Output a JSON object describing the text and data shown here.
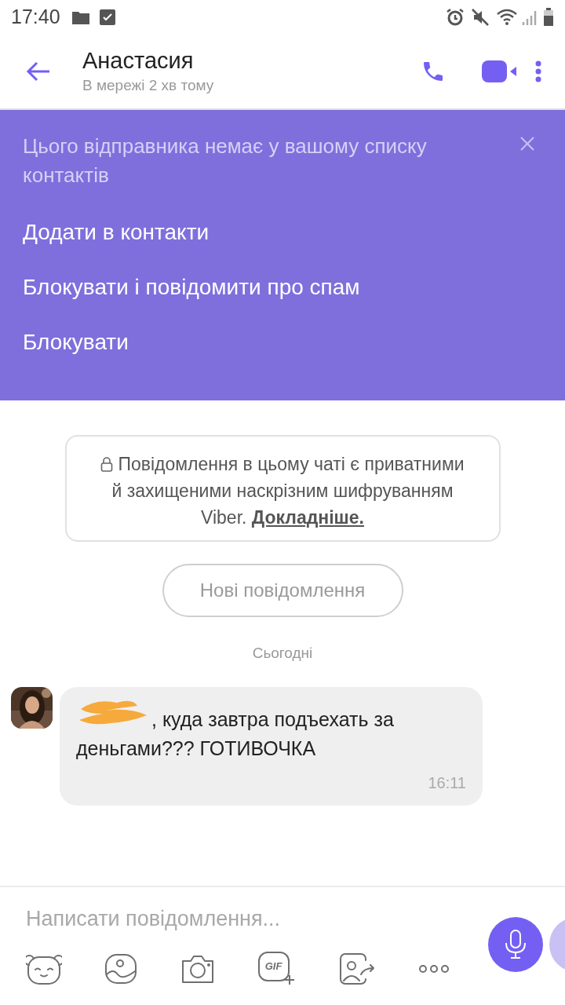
{
  "status_bar": {
    "time": "17:40"
  },
  "header": {
    "title": "Анастасия",
    "subtitle": "В мережі 2 хв тому"
  },
  "banner": {
    "title": "Цього відправника немає у вашому списку контактів",
    "actions": [
      "Додати в контакти",
      "Блокувати і повідомити про спам",
      "Блокувати"
    ]
  },
  "notice": {
    "text": "Повідомлення в цьому чаті є приватними й захищеними наскрізним шифруванням Viber.",
    "link": "Докладніше."
  },
  "new_messages_button": "Нові повідомлення",
  "date_divider": "Сьогодні",
  "messages": [
    {
      "text": ", куда завтра подъехать за деньгами??? ГОТИВОЧКА",
      "time": "16:11",
      "redacted": true
    }
  ],
  "composer": {
    "placeholder": "Написати повідомлення...",
    "tools": [
      {
        "kind": "sticker"
      },
      {
        "kind": "gallery"
      },
      {
        "kind": "camera"
      },
      {
        "kind": "gif",
        "label": "GIF"
      },
      {
        "kind": "share-contact"
      },
      {
        "kind": "more"
      }
    ]
  }
}
